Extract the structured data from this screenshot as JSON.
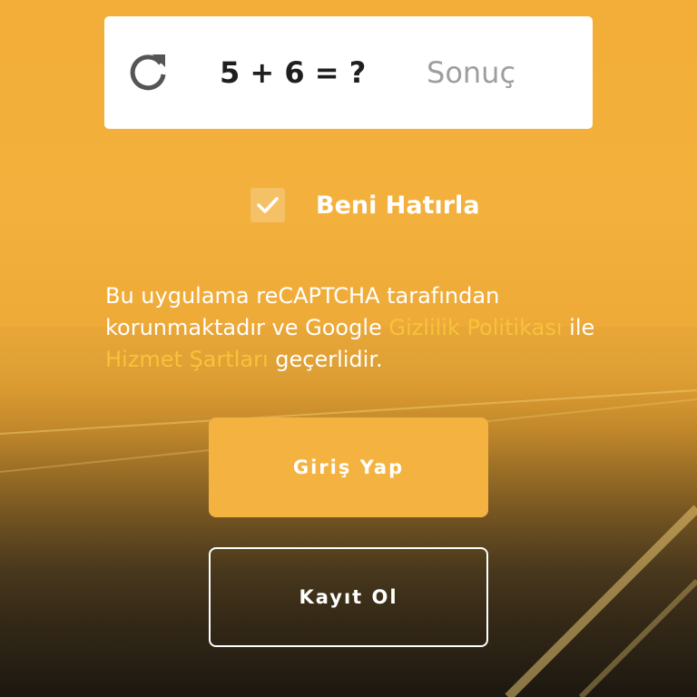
{
  "captcha": {
    "question": "5 + 6 = ?",
    "answer_placeholder": "Sonuç",
    "answer_value": "",
    "refresh_icon": "refresh-icon"
  },
  "remember_me": {
    "label": "Beni Hatırla",
    "checked": true,
    "check_icon": "checkmark-icon"
  },
  "legal": {
    "text_before": "Bu uygulama reCAPTCHA tarafından korunmaktadır ve Google ",
    "privacy_link": "Gizlilik Politikası",
    "text_middle": " ile ",
    "terms_link": "Hizmet Şartları",
    "text_after": " geçerlidir."
  },
  "buttons": {
    "login_label": "Giriş Yap",
    "register_label": "Kayıt Ol"
  },
  "colors": {
    "accent": "#f4b341",
    "link": "#f8c23b",
    "background_top": "#f2ae38",
    "background_bottom": "#2b2418"
  }
}
